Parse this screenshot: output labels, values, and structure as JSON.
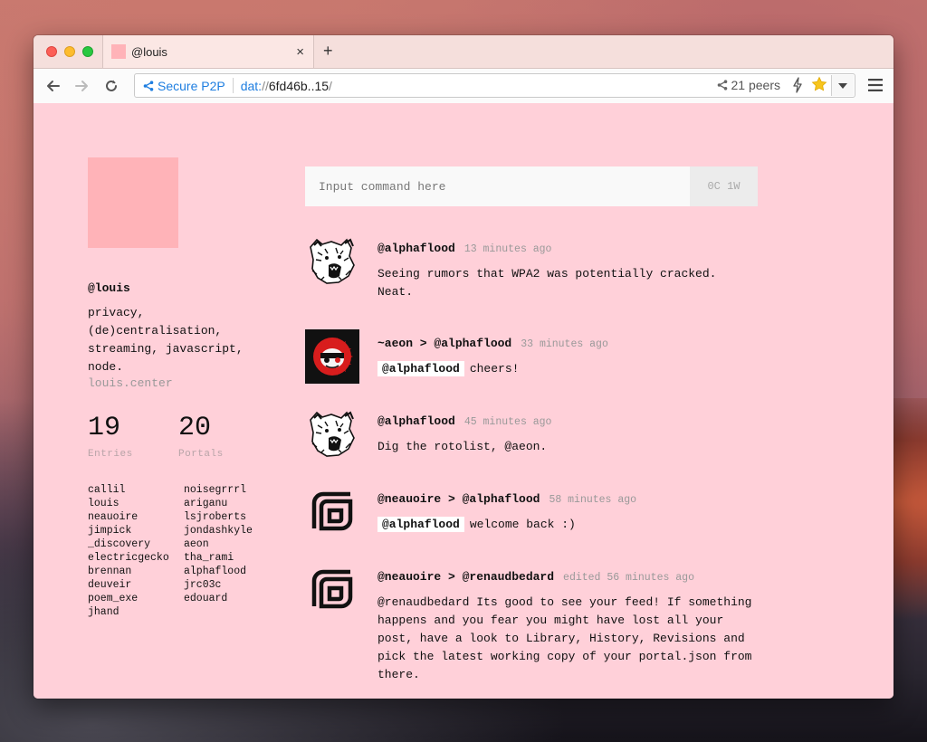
{
  "browser": {
    "tab_title": "@louis",
    "new_tab_label": "+",
    "address": {
      "secure_label": "Secure P2P",
      "url_protocol": "dat:",
      "url_slashes": "//",
      "url_host": "6fd46b..15",
      "url_trailing": "/",
      "peers_label": "21 peers"
    }
  },
  "profile": {
    "name": "@louis",
    "bio": "privacy, (de)centralisation, streaming, javascript, node.",
    "site": "louis.center",
    "stats": [
      {
        "value": "19",
        "label": "Entries"
      },
      {
        "value": "20",
        "label": "Portals"
      }
    ],
    "portals_col1": [
      "callil",
      "louis",
      "neauoire",
      "jimpick",
      "_discovery",
      "electricgecko",
      "brennan",
      "deuveir",
      "poem_exe",
      "jhand"
    ],
    "portals_col2": [
      "noisegrrrl",
      "ariganu",
      "lsjroberts",
      "jondashkyle",
      "aeon",
      "tha_rami",
      "alphaflood",
      "jrc03c",
      "edouard"
    ]
  },
  "command": {
    "placeholder": "Input command here",
    "status": "0C 1W"
  },
  "feed": [
    {
      "author": "@alphaflood",
      "time": "13 minutes ago",
      "mention": "",
      "text": "Seeing rumors that WPA2 was potentially cracked. Neat.",
      "avatar": "bear-avatar"
    },
    {
      "author": "~aeon > @alphaflood",
      "time": "33 minutes ago",
      "mention": "@alphaflood",
      "text": "cheers!",
      "avatar": "aeon-avatar"
    },
    {
      "author": "@alphaflood",
      "time": "45 minutes ago",
      "mention": "",
      "text": "Dig the rotolist, @aeon.",
      "avatar": "bear-avatar"
    },
    {
      "author": "@neauoire > @alphaflood",
      "time": "58 minutes ago",
      "mention": "@alphaflood",
      "text": "welcome back :)",
      "avatar": "neauoire-avatar"
    },
    {
      "author": "@neauoire > @renaudbedard",
      "time": "edited 56 minutes ago",
      "mention": "",
      "text": "@renaudbedard Its good to see your feed! If something happens and you fear you might have lost all your post, have a look to Library, History, Revisions and pick the latest working copy of your portal.json from there.",
      "avatar": "neauoire-avatar"
    }
  ],
  "colors": {
    "page_bg": "#ffd0d9",
    "accent_blue": "#1e7ee0",
    "avatar_pink": "#ffb3b8"
  }
}
